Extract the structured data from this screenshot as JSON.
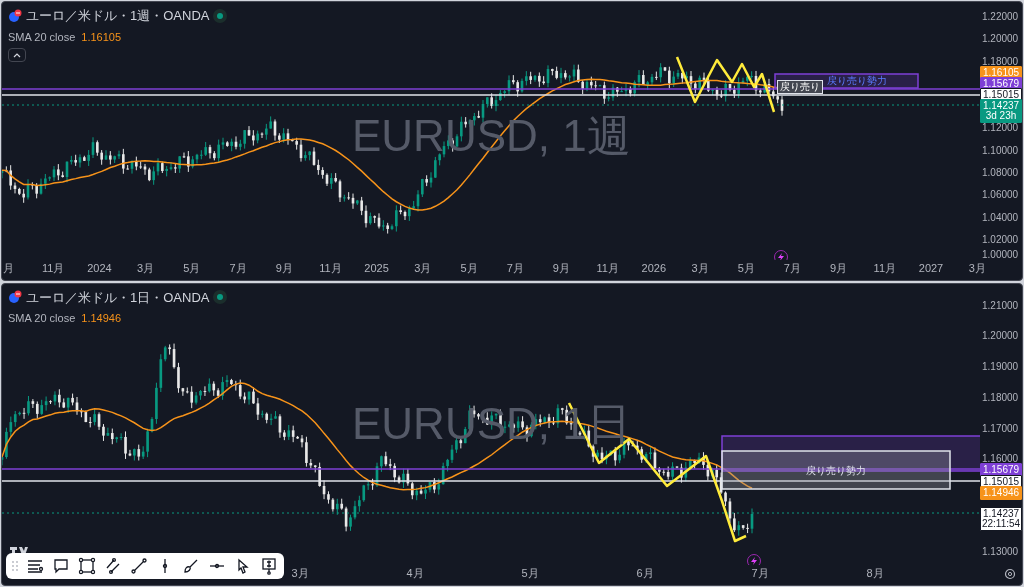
{
  "panels": [
    {
      "title": "ユーロ／米ドル・1週・OANDA",
      "market_open": true,
      "indicator": {
        "name": "SMA 20 close",
        "value": "1.16105"
      },
      "watermark": "EURUSD, 1週",
      "price_ticks": [
        "1.22000",
        "1.20000",
        "1.18000",
        "1.12000",
        "1.10000",
        "1.08000",
        "1.06000",
        "1.04000",
        "1.02000",
        "1.00000"
      ],
      "time_ticks": [
        "月",
        "11月",
        "2024",
        "3月",
        "5月",
        "7月",
        "9月",
        "11月",
        "2025",
        "3月",
        "5月",
        "7月",
        "9月",
        "11月",
        "2026",
        "3月",
        "5月",
        "7月",
        "9月",
        "11月",
        "2027",
        "3月"
      ],
      "price_badges": [
        {
          "price": "1.16105",
          "color": "#f7931a"
        },
        {
          "price": "1.15679",
          "color": "#7e3fd6"
        },
        {
          "price": "1.15015",
          "color": "#ffffff"
        },
        {
          "price": "1.14237",
          "countdown": "3d 23h",
          "color": "#089981"
        }
      ],
      "annotations": [
        {
          "kind": "zone",
          "text": "戻り売り勢力"
        },
        {
          "kind": "label",
          "text": "戻り売り"
        }
      ]
    },
    {
      "title": "ユーロ／米ドル・1日・OANDA",
      "market_open": true,
      "indicator": {
        "name": "SMA 20 close",
        "value": "1.14946"
      },
      "watermark": "EURUSD, 1日",
      "price_ticks": [
        "1.21000",
        "1.20000",
        "1.19000",
        "1.18000",
        "1.17000",
        "1.16000",
        "1.13000"
      ],
      "time_ticks": [
        "3月",
        "4月",
        "5月",
        "6月",
        "7月",
        "8月"
      ],
      "price_badges": [
        {
          "price": "1.15679",
          "color": "#7e3fd6"
        },
        {
          "price": "1.15015",
          "color": "#ffffff"
        },
        {
          "price": "1.14946",
          "color": "#f7931a"
        },
        {
          "price": "1.14237",
          "countdown": "22:11:54",
          "color": "#ffffff"
        }
      ],
      "annotations": [
        {
          "kind": "zone",
          "text": "戻り売り勢力"
        }
      ]
    }
  ]
}
